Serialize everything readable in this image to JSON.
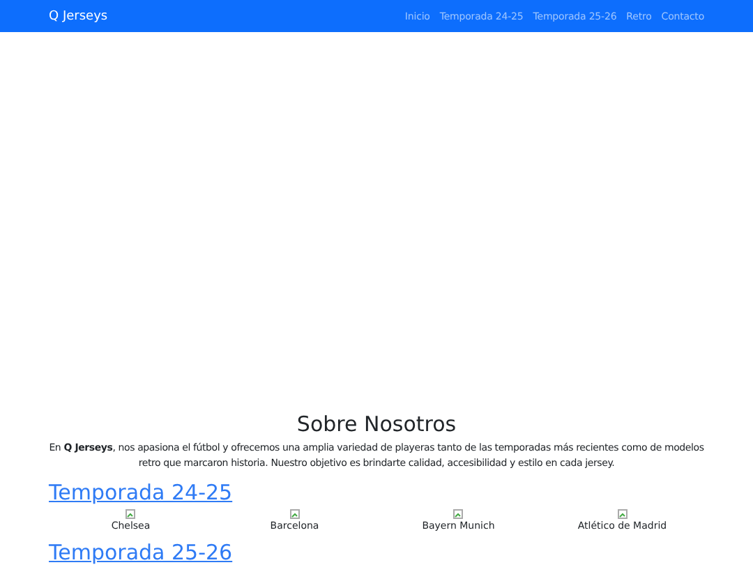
{
  "navbar": {
    "brand": "Q Jerseys",
    "links": [
      "Inicio",
      "Temporada 24-25",
      "Temporada 25-26",
      "Retro",
      "Contacto"
    ]
  },
  "about": {
    "title": "Sobre Nosotros",
    "text": "En **Q Jerseys**, nos apasiona el fútbol y ofrecemos una amplia variedad de playeras tanto de las temporadas más recientes como de modelos retro que marcaron historia. Nuestro objetivo es brindarte calidad, accesibilidad y estilo en cada jersey."
  },
  "sections": [
    {
      "title": "Temporada 24-25",
      "items": [
        {
          "caption": "Chelsea"
        },
        {
          "caption": "Barcelona"
        },
        {
          "caption": "Bayern Munich"
        },
        {
          "caption": "Atlético de Madrid"
        }
      ]
    },
    {
      "title": "Temporada 25-26"
    }
  ]
}
